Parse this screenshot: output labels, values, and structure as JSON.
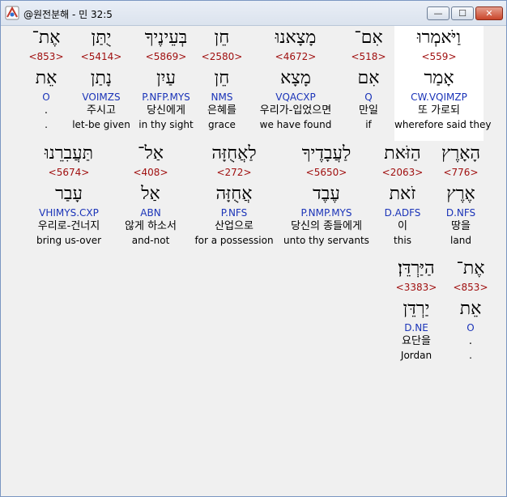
{
  "window": {
    "title": "@원전분해 - 민 32:5",
    "min_label": "—",
    "max_label": "☐",
    "close_label": "✕"
  },
  "rows": [
    [
      {
        "word": "וַיֹּאמְרוּ",
        "strong": "<559>",
        "lemma": "אָמַר",
        "parse": "CW.VQIMZP",
        "korean": "또 가로되",
        "english": "wherefore said they",
        "selected": true
      },
      {
        "word": "אִם־",
        "strong": "<518>",
        "lemma": "אִם",
        "parse": "Q",
        "korean": "만일",
        "english": "if"
      },
      {
        "word": "מָצָאנוּ",
        "strong": "<4672>",
        "lemma": "מָצָא",
        "parse": "VQACXP",
        "korean": "우리가-입었으면",
        "english": "we have found"
      },
      {
        "word": "חֵן",
        "strong": "<2580>",
        "lemma": "חֵן",
        "parse": "NMS",
        "korean": "은혜를",
        "english": "grace"
      },
      {
        "word": "בְּעֵינֶיךָ",
        "strong": "<5869>",
        "lemma": "עַיִן",
        "parse": "P.NFP.MYS",
        "korean": "당신에게",
        "english": "in thy sight"
      },
      {
        "word": "יֻתַּן",
        "strong": "<5414>",
        "lemma": "נָתַן",
        "parse": "VOIMZS",
        "korean": "주시고",
        "english": "let-be given"
      },
      {
        "word": "אֶת־",
        "strong": "<853>",
        "lemma": "אֵת",
        "parse": "O",
        "korean": ".",
        "english": "."
      }
    ],
    [
      {
        "word": "הָאָרֶץ",
        "strong": "<776>",
        "lemma": "אֶרֶץ",
        "parse": "D.NFS",
        "korean": "땅을",
        "english": "land"
      },
      {
        "word": "הַזֹּאת",
        "strong": "<2063>",
        "lemma": "זֹאת",
        "parse": "D.ADFS",
        "korean": "이",
        "english": "this"
      },
      {
        "word": "לַעֲבָדֶיךָ",
        "strong": "<5650>",
        "lemma": "עֶבֶד",
        "parse": "P.NMP.MYS",
        "korean": "당신의 종들에게",
        "english": "unto thy servants"
      },
      {
        "word": "לַאֲחֻזָּה",
        "strong": "<272>",
        "lemma": "אֲחֻזָּה",
        "parse": "P.NFS",
        "korean": "산업으로",
        "english": "for a possession"
      },
      {
        "word": "אַל־",
        "strong": "<408>",
        "lemma": "אַל",
        "parse": "ABN",
        "korean": "않게 하소서",
        "english": "and-not"
      },
      {
        "word": "תַּעֲבִרֵנוּ",
        "strong": "<5674>",
        "lemma": "עָבַר",
        "parse": "VHIMYS.CXP",
        "korean": "우리로-건너지",
        "english": "bring us-over"
      }
    ],
    [
      {
        "word": "אֶת־",
        "strong": "<853>",
        "lemma": "אֵת",
        "parse": "O",
        "korean": ".",
        "english": "."
      },
      {
        "word": "הַיַּרְדֵּן׃",
        "strong": "<3383>",
        "lemma": "יַרְדֵּן",
        "parse": "D.NE",
        "korean": "요단을",
        "english": "Jordan"
      }
    ]
  ]
}
